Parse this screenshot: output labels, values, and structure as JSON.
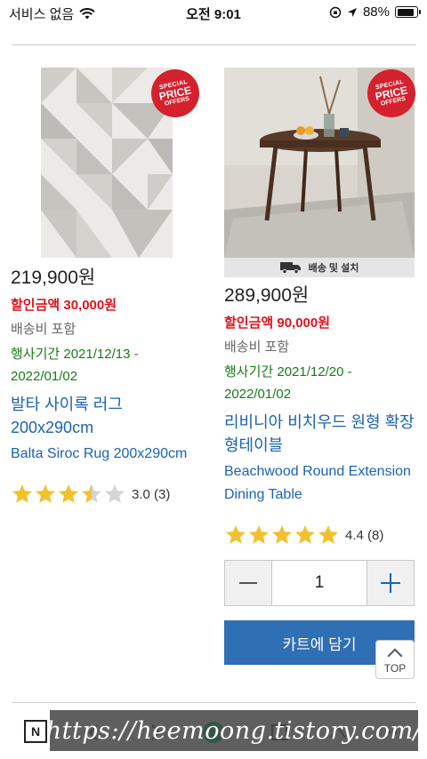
{
  "status_bar": {
    "carrier": "서비스 없음",
    "time": "오전 9:01",
    "battery": "88%",
    "battery_level": 0.88
  },
  "badge": {
    "line1": "SPECIAL",
    "line2": "PRICE",
    "line3": "OFFERS"
  },
  "products": [
    {
      "price": "219,900원",
      "discount": "할인금액 30,000원",
      "shipping": "배송비 포함",
      "period": "행사기간 2021/12/13 - 2022/01/02",
      "name_ko": "발타 사이록 러그 200x290cm",
      "name_en": "Balta Siroc Rug 200x290cm",
      "rating_value": 3.0,
      "rating": "3.0 (3)"
    },
    {
      "delivery_label": "배송 및 설치",
      "price": "289,900원",
      "discount": "할인금액 90,000원",
      "shipping": "배송비 포함",
      "period": "행사기간 2021/12/20 - 2022/01/02",
      "name_ko": "리비니아 비치우드 원형 확장형테이블",
      "name_en": "Beachwood Round Extension Dining Table",
      "rating_value": 4.4,
      "rating": "4.4 (8)",
      "quantity": "1",
      "cart_label": "카트에 담기"
    }
  ],
  "top_button": "TOP",
  "toolbar": {
    "n_button": "N"
  },
  "watermark": "https://heemoong.tistory.com/",
  "colors": {
    "price_red": "#e0111b",
    "period_green": "#1a7a1a",
    "link_blue": "#1b63b0",
    "cart_blue": "#2f6fb3",
    "star_gold": "#f2c12e",
    "badge_red": "#d5212e"
  }
}
